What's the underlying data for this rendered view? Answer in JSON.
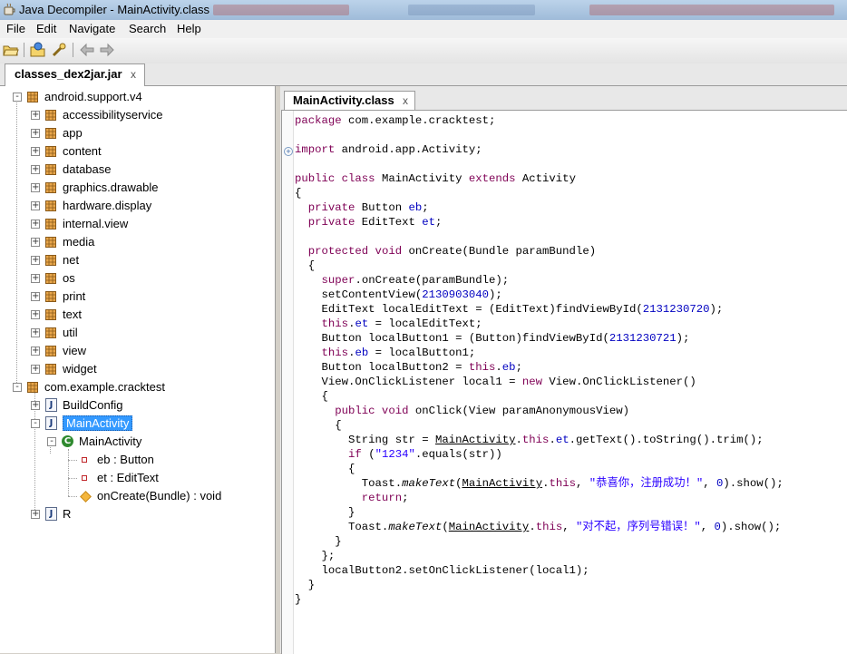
{
  "window": {
    "title": "Java Decompiler - MainActivity.class"
  },
  "menu": [
    "File",
    "Edit",
    "Navigate",
    "Search",
    "Help"
  ],
  "file_tab": {
    "label": "classes_dex2jar.jar",
    "close": "x"
  },
  "code_tab": {
    "label": "MainActivity.class",
    "close": "x"
  },
  "tree": [
    {
      "label": "android.support.v4",
      "depth": 0,
      "icon": "package",
      "expand": "-"
    },
    {
      "label": "accessibilityservice",
      "depth": 1,
      "icon": "package",
      "expand": "+"
    },
    {
      "label": "app",
      "depth": 1,
      "icon": "package",
      "expand": "+"
    },
    {
      "label": "content",
      "depth": 1,
      "icon": "package",
      "expand": "+"
    },
    {
      "label": "database",
      "depth": 1,
      "icon": "package",
      "expand": "+"
    },
    {
      "label": "graphics.drawable",
      "depth": 1,
      "icon": "package",
      "expand": "+"
    },
    {
      "label": "hardware.display",
      "depth": 1,
      "icon": "package",
      "expand": "+"
    },
    {
      "label": "internal.view",
      "depth": 1,
      "icon": "package",
      "expand": "+"
    },
    {
      "label": "media",
      "depth": 1,
      "icon": "package",
      "expand": "+"
    },
    {
      "label": "net",
      "depth": 1,
      "icon": "package",
      "expand": "+"
    },
    {
      "label": "os",
      "depth": 1,
      "icon": "package",
      "expand": "+"
    },
    {
      "label": "print",
      "depth": 1,
      "icon": "package",
      "expand": "+"
    },
    {
      "label": "text",
      "depth": 1,
      "icon": "package",
      "expand": "+"
    },
    {
      "label": "util",
      "depth": 1,
      "icon": "package",
      "expand": "+"
    },
    {
      "label": "view",
      "depth": 1,
      "icon": "package",
      "expand": "+"
    },
    {
      "label": "widget",
      "depth": 1,
      "icon": "package",
      "expand": "+"
    },
    {
      "label": "com.example.cracktest",
      "depth": 0,
      "icon": "package",
      "expand": "-"
    },
    {
      "label": "BuildConfig",
      "depth": 1,
      "icon": "java-file",
      "expand": "+"
    },
    {
      "label": "MainActivity",
      "depth": 1,
      "icon": "java-file",
      "expand": "-",
      "selected": true
    },
    {
      "label": "MainActivity",
      "depth": 2,
      "icon": "class",
      "expand": "-"
    },
    {
      "label": "eb : Button",
      "depth": 3,
      "icon": "field",
      "expand": ""
    },
    {
      "label": "et : EditText",
      "depth": 3,
      "icon": "field",
      "expand": ""
    },
    {
      "label": "onCreate(Bundle) : void",
      "depth": 3,
      "icon": "method",
      "expand": ""
    },
    {
      "label": "R",
      "depth": 1,
      "icon": "java-file",
      "expand": "+"
    }
  ],
  "code": [
    "<k>package</k> com.example.cracktest;",
    "",
    "<k>import</k> android.app.Activity;",
    "",
    "<k>public class</k> MainActivity <k>extends</k> Activity",
    "{",
    "  <k>private</k> Button <f>eb</f>;",
    "  <k>private</k> EditText <f>et</f>;",
    "",
    "  <k>protected void</k> onCreate(Bundle paramBundle)",
    "  {",
    "    <k>super</k>.onCreate(paramBundle);",
    "    setContentView(<n>2130903040</n>);",
    "    EditText localEditText = (EditText)findViewById(<n>2131230720</n>);",
    "    <k>this</k>.<f>et</f> = localEditText;",
    "    Button localButton1 = (Button)findViewById(<n>2131230721</n>);",
    "    <k>this</k>.<f>eb</f> = localButton1;",
    "    Button localButton2 = <k>this</k>.<f>eb</f>;",
    "    View.OnClickListener local1 = <k>new</k> View.OnClickListener()",
    "    {",
    "      <k>public void</k> onClick(View paramAnonymousView)",
    "      {",
    "        String str = <u>MainActivity</u>.<k>this</k>.<f>et</f>.getText().toString().trim();",
    "        <k>if</k> (<s>\"1234\"</s>.equals(str))",
    "        {",
    "          Toast.<i>makeText</i>(<u>MainActivity</u>.<k>this</k>, <s>\"恭喜你，注册成功！\"</s>, <n>0</n>).show();",
    "          <k>return</k>;",
    "        }",
    "        Toast.<i>makeText</i>(<u>MainActivity</u>.<k>this</k>, <s>\"对不起，序列号错误！\"</s>, <n>0</n>).show();",
    "      }",
    "    };",
    "    localButton2.setOnClickListener(local1);",
    "  }",
    "}"
  ],
  "code_fold_markers": {
    "import_line": "+"
  }
}
